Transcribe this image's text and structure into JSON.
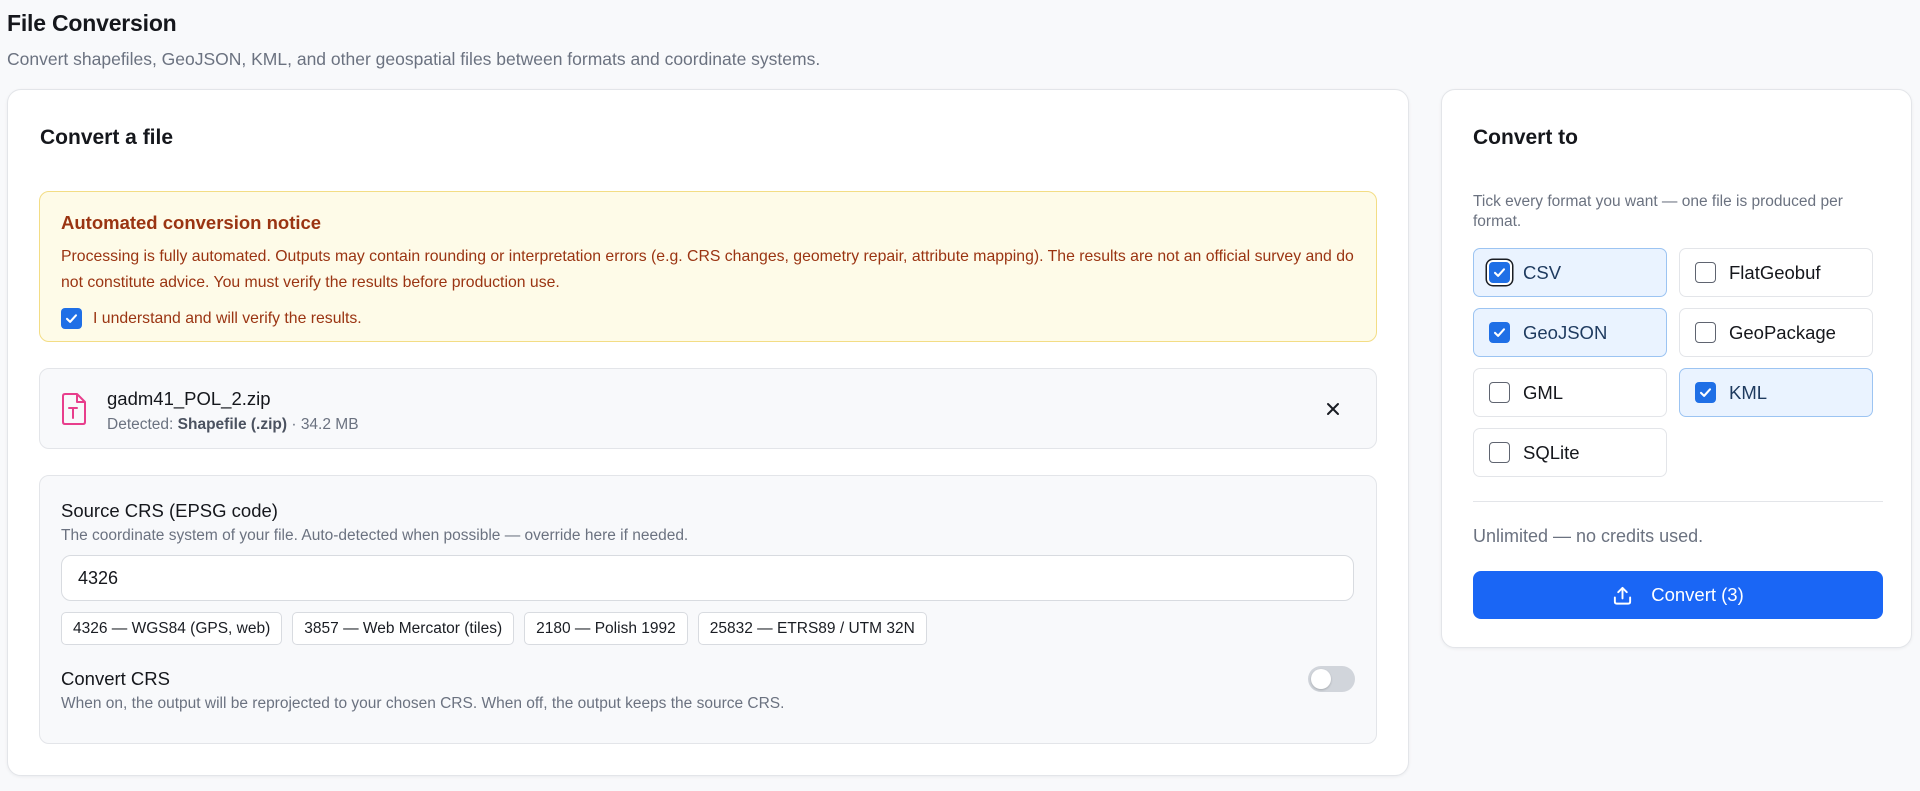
{
  "header": {
    "title": "File Conversion",
    "subtitle": "Convert shapefiles, GeoJSON, KML, and other geospatial files between formats and coordinate systems."
  },
  "main": {
    "title": "Convert a file",
    "notice": {
      "title": "Automated conversion notice",
      "body": "Processing is fully automated. Outputs may contain rounding or interpretation errors (e.g. CRS changes, geometry repair, attribute mapping). The results are not an official survey and do not constitute advice. You must verify the results before production use.",
      "ack_label": "I understand and will verify the results.",
      "ack_checked": true
    },
    "file": {
      "name": "gadm41_POL_2.zip",
      "detected_prefix": "Detected: ",
      "detected_type": "Shapefile (.zip)",
      "separator": " · ",
      "size": "34.2 MB",
      "icon": "file-type-icon",
      "icon_color": "#e83e8c"
    },
    "crs": {
      "label": "Source CRS (EPSG code)",
      "help": "The coordinate system of your file. Auto-detected when possible — override here if needed.",
      "value": "4326",
      "presets": [
        "4326 — WGS84 (GPS, web)",
        "3857 — Web Mercator (tiles)",
        "2180 — Polish 1992",
        "25832 — ETRS89 / UTM 32N"
      ],
      "convert_label": "Convert CRS",
      "convert_help": "When on, the output will be reprojected to your chosen CRS. When off, the output keeps the source CRS.",
      "convert_enabled": false
    }
  },
  "side": {
    "title": "Convert to",
    "help": "Tick every format you want — one file is produced per format.",
    "formats": [
      {
        "label": "CSV",
        "checked": true
      },
      {
        "label": "FlatGeobuf",
        "checked": false
      },
      {
        "label": "GeoJSON",
        "checked": true
      },
      {
        "label": "GeoPackage",
        "checked": false
      },
      {
        "label": "GML",
        "checked": false
      },
      {
        "label": "KML",
        "checked": true
      },
      {
        "label": "SQLite",
        "checked": false
      }
    ],
    "credits": "Unlimited — no credits used.",
    "convert_button": "Convert (3)",
    "convert_icon": "upload-icon"
  },
  "colors": {
    "accent": "#1a66f5",
    "checkbox": "#1f6fe6",
    "notice_bg": "#fefbe8",
    "notice_text": "#9a3412",
    "selected_bg": "#eaf3ff"
  }
}
